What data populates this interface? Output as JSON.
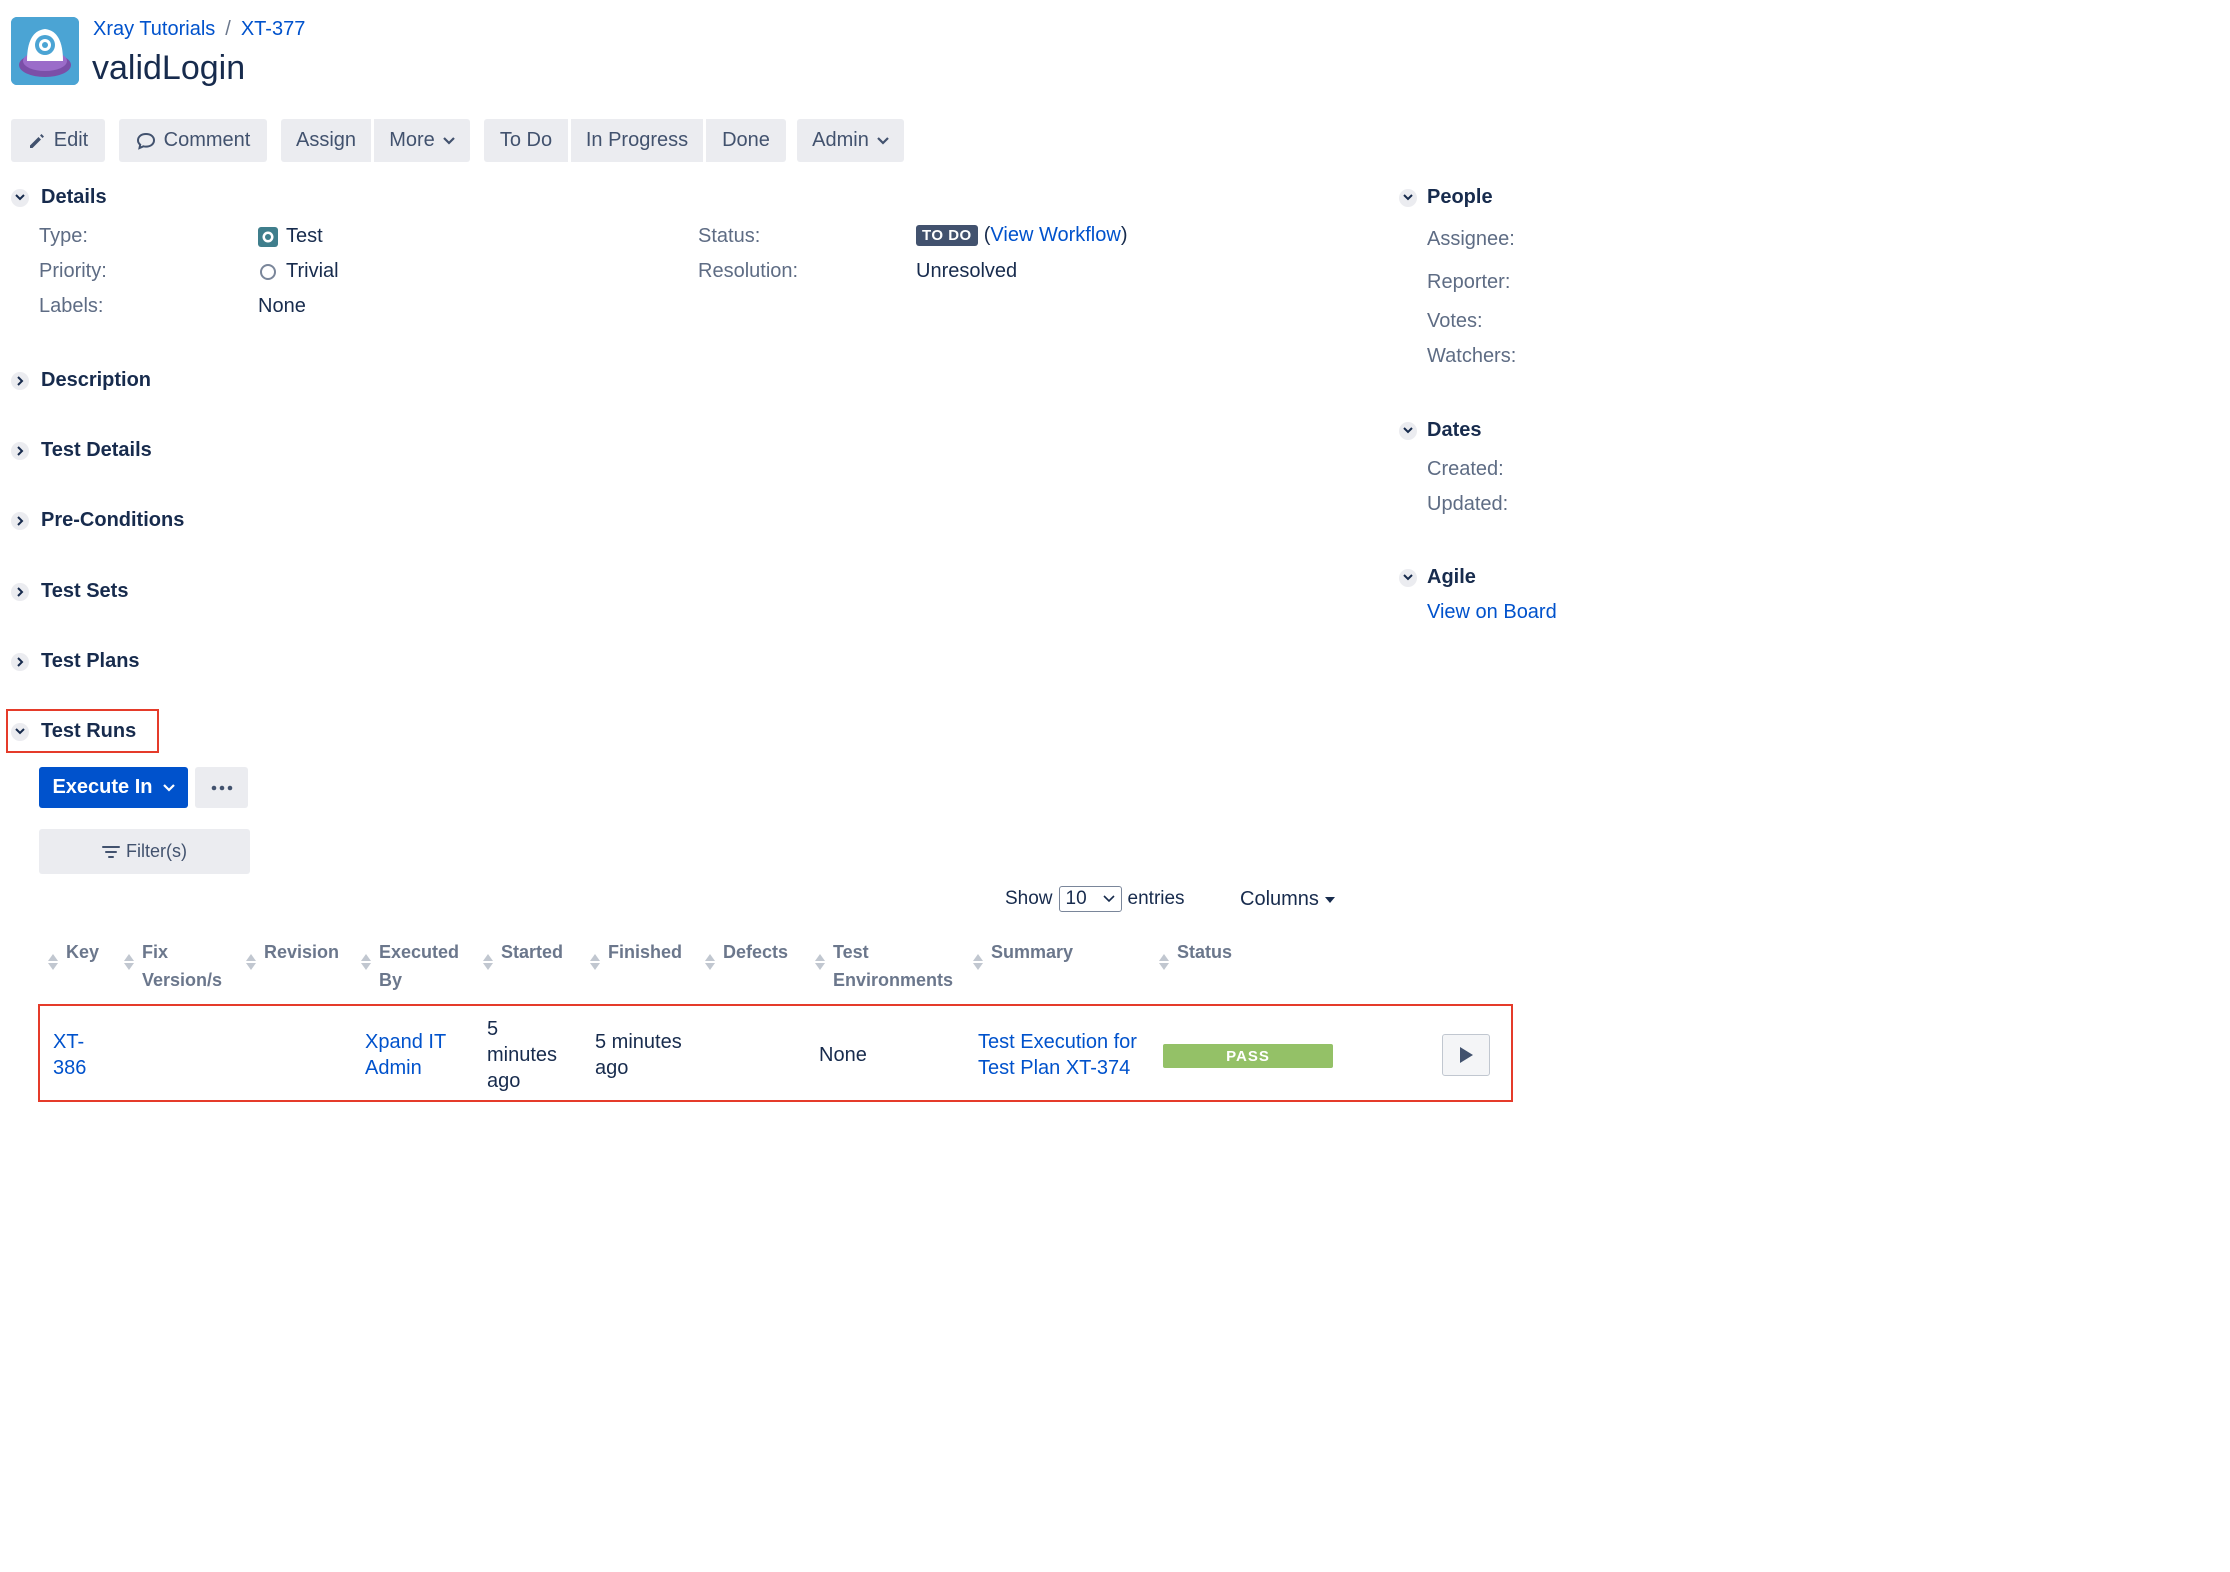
{
  "breadcrumb": {
    "project": "Xray Tutorials",
    "separator": "/",
    "issue_key": "XT-377"
  },
  "issue": {
    "title": "validLogin"
  },
  "toolbar": {
    "edit": "Edit",
    "comment": "Comment",
    "assign": "Assign",
    "more": "More",
    "todo": "To Do",
    "in_progress": "In Progress",
    "done": "Done",
    "admin": "Admin"
  },
  "details": {
    "heading": "Details",
    "type_label": "Type:",
    "type_value": "Test",
    "priority_label": "Priority:",
    "priority_value": "Trivial",
    "labels_label": "Labels:",
    "labels_value": "None",
    "status_label": "Status:",
    "status_value": "TO DO",
    "view_workflow_open": "(",
    "view_workflow": "View Workflow",
    "view_workflow_close": ")",
    "resolution_label": "Resolution:",
    "resolution_value": "Unresolved"
  },
  "sections": {
    "description": "Description",
    "test_details": "Test Details",
    "pre_conditions": "Pre-Conditions",
    "test_sets": "Test Sets",
    "test_plans": "Test Plans",
    "test_runs": "Test Runs"
  },
  "people": {
    "heading": "People",
    "assignee": "Assignee:",
    "reporter": "Reporter:",
    "votes": "Votes:",
    "watchers": "Watchers:"
  },
  "dates": {
    "heading": "Dates",
    "created": "Created:",
    "updated": "Updated:"
  },
  "agile": {
    "heading": "Agile",
    "view_on_board": "View on Board"
  },
  "test_runs": {
    "execute_in": "Execute In",
    "filters": "Filter(s)",
    "show": "Show",
    "entries_value": "10",
    "entries": "entries",
    "columns": "Columns",
    "headers": {
      "key": "Key",
      "fix_versions_1": "Fix",
      "fix_versions_2": "Version/s",
      "revision": "Revision",
      "executed_by_1": "Executed",
      "executed_by_2": "By",
      "started": "Started",
      "finished": "Finished",
      "defects": "Defects",
      "test_env_1": "Test",
      "test_env_2": "Environments",
      "summary": "Summary",
      "status": "Status"
    },
    "row": {
      "key_1": "XT-",
      "key_2": "386",
      "executed_by_1": "Xpand IT",
      "executed_by_2": "Admin",
      "started_1": "5",
      "started_2": "minutes",
      "started_3": "ago",
      "finished_1": "5 minutes",
      "finished_2": "ago",
      "test_environments": "None",
      "summary_1": "Test Execution for",
      "summary_2": "Test Plan XT-374",
      "status": "PASS"
    }
  },
  "colors": {
    "link": "#0052cc",
    "primary_button": "#0052cc",
    "pass": "#94c167",
    "highlight": "#e53b2a",
    "lozenge_todo": "#42526e"
  }
}
